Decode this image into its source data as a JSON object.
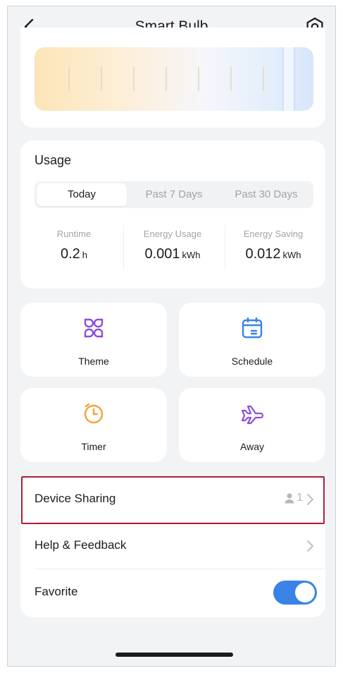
{
  "header": {
    "title": "Smart Bulb",
    "back_icon": "chevron-left-icon",
    "settings_icon": "gear-icon"
  },
  "color_temperature": {
    "gradient_colors": [
      "#fbe5b8",
      "#f5f6fb",
      "#d7e6fa"
    ]
  },
  "usage": {
    "title": "Usage",
    "tabs": [
      {
        "label": "Today",
        "active": true
      },
      {
        "label": "Past 7 Days",
        "active": false
      },
      {
        "label": "Past 30 Days",
        "active": false
      }
    ],
    "stats": [
      {
        "label": "Runtime",
        "value": "0.2",
        "unit": "h"
      },
      {
        "label": "Energy Usage",
        "value": "0.001",
        "unit": "kWh"
      },
      {
        "label": "Energy Saving",
        "value": "0.012",
        "unit": "kWh"
      }
    ]
  },
  "features": [
    {
      "label": "Theme",
      "icon": "theme-icon",
      "color": "#8b4fd8"
    },
    {
      "label": "Schedule",
      "icon": "calendar-icon",
      "color": "#3a83e6"
    },
    {
      "label": "Timer",
      "icon": "clock-icon",
      "color": "#f2a33a"
    },
    {
      "label": "Away",
      "icon": "airplane-icon",
      "color": "#8b4fd8"
    }
  ],
  "list": {
    "device_sharing": {
      "label": "Device Sharing",
      "count": "1",
      "icon": "person-icon"
    },
    "help": {
      "label": "Help & Feedback"
    },
    "favorite": {
      "label": "Favorite",
      "enabled": true
    }
  },
  "colors": {
    "accent": "#3a83e6",
    "highlight": "#b11e3a"
  }
}
